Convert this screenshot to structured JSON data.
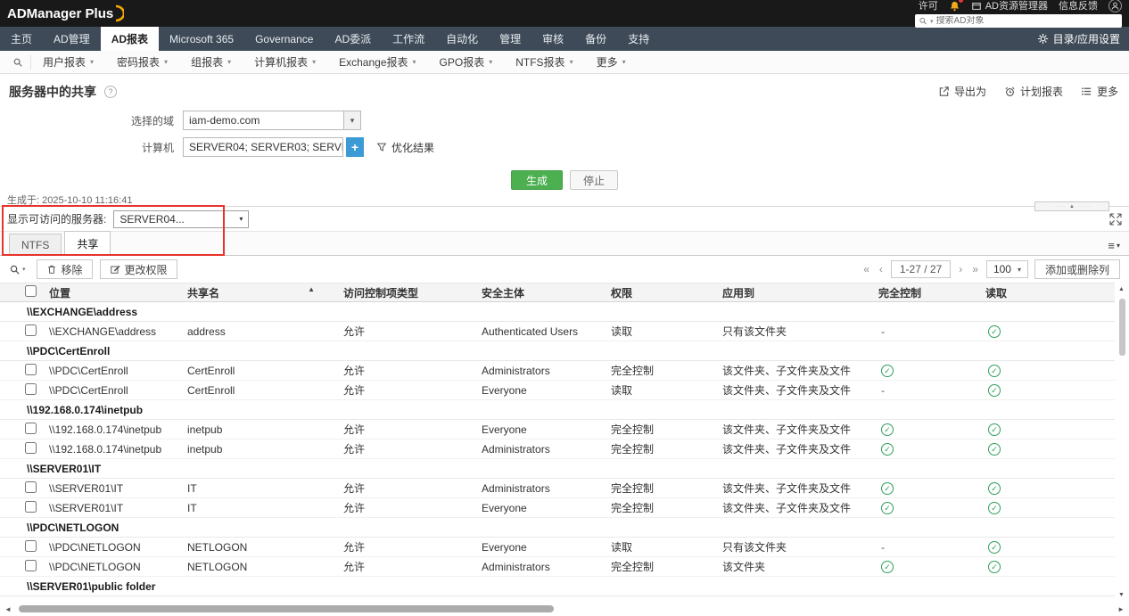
{
  "icons": {
    "caret_down": "▾",
    "sort_asc": "▲",
    "scroll_up": "▲",
    "scroll_down": "▼",
    "scroll_left": "◄",
    "scroll_right": "►",
    "page_first": "«",
    "page_prev": "‹",
    "page_next": "›",
    "page_last": "»",
    "check": "✓",
    "menu": "≡",
    "plus": "+",
    "help": "?",
    "handle_dots": "······"
  },
  "topbar": {
    "logo": "ADManager Plus",
    "license": "许可",
    "resource_explorer": "AD资源管理器",
    "feedback": "信息反馈",
    "search_placeholder": "搜索AD对象"
  },
  "nav": {
    "tabs": [
      "主页",
      "AD管理",
      "AD报表",
      "Microsoft 365",
      "Governance",
      "AD委派",
      "工作流",
      "自动化",
      "管理",
      "审核",
      "备份",
      "支持"
    ],
    "active": "AD报表",
    "settings": "目录/应用设置"
  },
  "reports_nav": {
    "items": [
      "用户报表",
      "密码报表",
      "组报表",
      "计算机报表",
      "Exchange报表",
      "GPO报表",
      "NTFS报表",
      "更多"
    ]
  },
  "page": {
    "title": "服务器中的共享",
    "export": "导出为",
    "schedule": "计划报表",
    "more": "更多"
  },
  "form": {
    "domain_label": "选择的域",
    "domain_value": "iam-demo.com",
    "computers_label": "计算机",
    "computers_value": "SERVER04; SERVER03; SERVE...",
    "refine_label": "优化结果",
    "generate": "生成",
    "stop": "停止",
    "generated_at": "生成于: 2025-10-10 11:16:41"
  },
  "results": {
    "server_label": "显示可访问的服务器:",
    "server_value": "SERVER04...",
    "view_tabs": {
      "tabs": [
        "NTFS",
        "共享"
      ],
      "active": "共享"
    },
    "toolbar": {
      "remove": "移除",
      "change_permission": "更改权限",
      "page_range": "1-27 / 27",
      "page_size": "100",
      "add_remove_columns": "添加或删除列"
    }
  },
  "table": {
    "columns": [
      "位置",
      "共享名",
      "访问控制项类型",
      "安全主体",
      "权限",
      "应用到",
      "完全控制",
      "读取"
    ],
    "sorted_column": "共享名",
    "rows": [
      {
        "type": "group",
        "label": "\\\\EXCHANGE\\address"
      },
      {
        "type": "data",
        "location": "\\\\EXCHANGE\\address",
        "share": "address",
        "ace": "允许",
        "principal": "Authenticated Users",
        "permission": "读取",
        "applies": "只有该文件夹",
        "full_control": "-",
        "read": "check"
      },
      {
        "type": "group",
        "label": "\\\\PDC\\CertEnroll"
      },
      {
        "type": "data",
        "location": "\\\\PDC\\CertEnroll",
        "share": "CertEnroll",
        "ace": "允许",
        "principal": "Administrators",
        "permission": "完全控制",
        "applies": "该文件夹、子文件夹及文件",
        "full_control": "check",
        "read": "check"
      },
      {
        "type": "data",
        "location": "\\\\PDC\\CertEnroll",
        "share": "CertEnroll",
        "ace": "允许",
        "principal": "Everyone",
        "permission": "读取",
        "applies": "该文件夹、子文件夹及文件",
        "full_control": "-",
        "read": "check"
      },
      {
        "type": "group",
        "label": "\\\\192.168.0.174\\inetpub"
      },
      {
        "type": "data",
        "location": "\\\\192.168.0.174\\inetpub",
        "share": "inetpub",
        "ace": "允许",
        "principal": "Everyone",
        "permission": "完全控制",
        "applies": "该文件夹、子文件夹及文件",
        "full_control": "check",
        "read": "check"
      },
      {
        "type": "data",
        "location": "\\\\192.168.0.174\\inetpub",
        "share": "inetpub",
        "ace": "允许",
        "principal": "Administrators",
        "permission": "完全控制",
        "applies": "该文件夹、子文件夹及文件",
        "full_control": "check",
        "read": "check"
      },
      {
        "type": "group",
        "label": "\\\\SERVER01\\IT"
      },
      {
        "type": "data",
        "location": "\\\\SERVER01\\IT",
        "share": "IT",
        "ace": "允许",
        "principal": "Administrators",
        "permission": "完全控制",
        "applies": "该文件夹、子文件夹及文件",
        "full_control": "check",
        "read": "check"
      },
      {
        "type": "data",
        "location": "\\\\SERVER01\\IT",
        "share": "IT",
        "ace": "允许",
        "principal": "Everyone",
        "permission": "完全控制",
        "applies": "该文件夹、子文件夹及文件",
        "full_control": "check",
        "read": "check"
      },
      {
        "type": "group",
        "label": "\\\\PDC\\NETLOGON"
      },
      {
        "type": "data",
        "location": "\\\\PDC\\NETLOGON",
        "share": "NETLOGON",
        "ace": "允许",
        "principal": "Everyone",
        "permission": "读取",
        "applies": "只有该文件夹",
        "full_control": "-",
        "read": "check"
      },
      {
        "type": "data",
        "location": "\\\\PDC\\NETLOGON",
        "share": "NETLOGON",
        "ace": "允许",
        "principal": "Administrators",
        "permission": "完全控制",
        "applies": "该文件夹",
        "full_control": "check",
        "read": "check"
      },
      {
        "type": "group",
        "label": "\\\\SERVER01\\public folder"
      }
    ]
  }
}
